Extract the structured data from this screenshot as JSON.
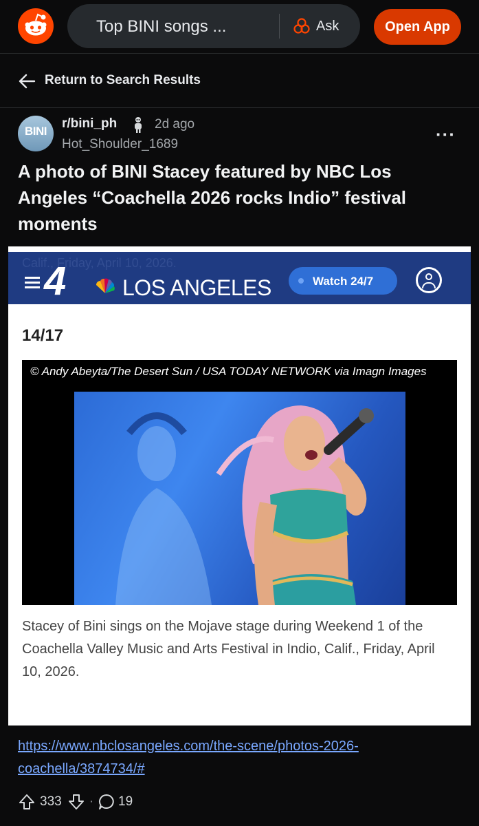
{
  "topbar": {
    "search_text": "Top BINI songs ...",
    "ask_label": "Ask",
    "open_app_label": "Open App",
    "brand_color": "#ff4500"
  },
  "nav": {
    "return_label": "Return to Search Results"
  },
  "post": {
    "avatar_text": "BINI",
    "subreddit": "r/bini_ph",
    "time": "2d ago",
    "author": "Hot_Shoulder_1689",
    "more_label": "···",
    "title": "A photo of BINI Stacey featured by NBC Los Angeles “Coachella 2026 rocks Indio” festival moments",
    "link": "https://www.nbclosangeles.com/the-scene/photos-2026-coachella/3874734/#",
    "upvotes": "333",
    "dot": "·",
    "comments": "19"
  },
  "embed": {
    "ghost_text": "Calif., Friday, April 10, 2026.",
    "channel_number": "4",
    "station": "LOS ANGELES",
    "watch_label": "Watch 24/7",
    "counter": "14/17",
    "credit": "© Andy Abeyta/The Desert Sun / USA TODAY NETWORK via Imagn Images",
    "caption": "Stacey of Bini sings on the Mojave stage during Weekend 1 of the Coachella Valley Music and Arts Festival in Indio, Calif., Friday, April 10, 2026.",
    "header_color": "#1f3b82",
    "watch_color": "#2f6fd6"
  },
  "icons": {
    "logo": "reddit-snoo-icon",
    "ask": "ask-answers-icon",
    "back": "arrow-left-icon",
    "sub_badge": "subreddit-mod-icon",
    "more": "more-options-icon",
    "hamburger": "menu-icon",
    "peacock": "nbc-peacock-icon",
    "account": "account-icon",
    "upvote": "upvote-icon",
    "downvote": "downvote-icon",
    "comment": "comment-icon"
  }
}
